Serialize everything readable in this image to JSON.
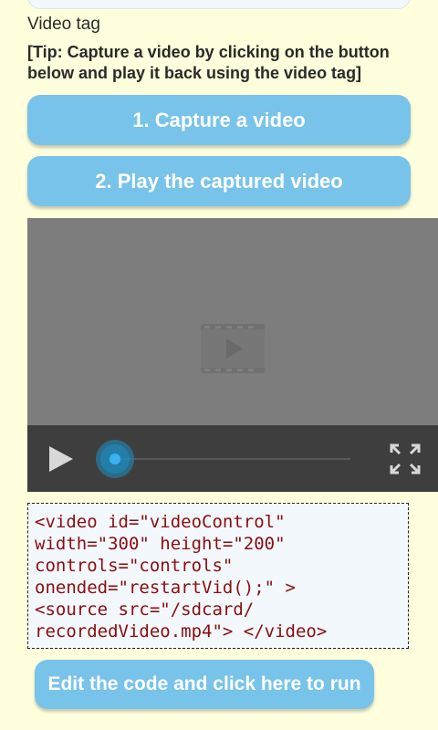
{
  "section": {
    "title": "Video tag",
    "tip": "[Tip: Capture a video by clicking on the button below and play it back using the video tag]"
  },
  "buttons": {
    "capture_label": "1. Capture a video",
    "play_label": "2. Play the captured video",
    "run_label": "Edit the code and click here to run"
  },
  "video_player": {
    "placeholder_icon": "film-play-icon",
    "controls": {
      "play_icon": "play-icon",
      "seek_icon": "seek-knob-icon",
      "fullscreen_icon": "fullscreen-icon",
      "progress": 0
    }
  },
  "code": {
    "text": "<video id=\"videoControl\"\nwidth=\"300\" height=\"200\"\ncontrols=\"controls\"\nonended=\"restartVid();\" >\n<source src=\"/sdcard/\nrecordedVideo.mp4\"> </video>"
  },
  "colors": {
    "background": "#ffffdd",
    "button": "#78c3ea",
    "button_text": "#ffffff",
    "code_text": "#8b0d0d",
    "code_background": "#f3f8fd",
    "video_background": "#7d7d7d",
    "video_controls": "#3e3e3e",
    "seek_knob": "#1d8fc4"
  }
}
